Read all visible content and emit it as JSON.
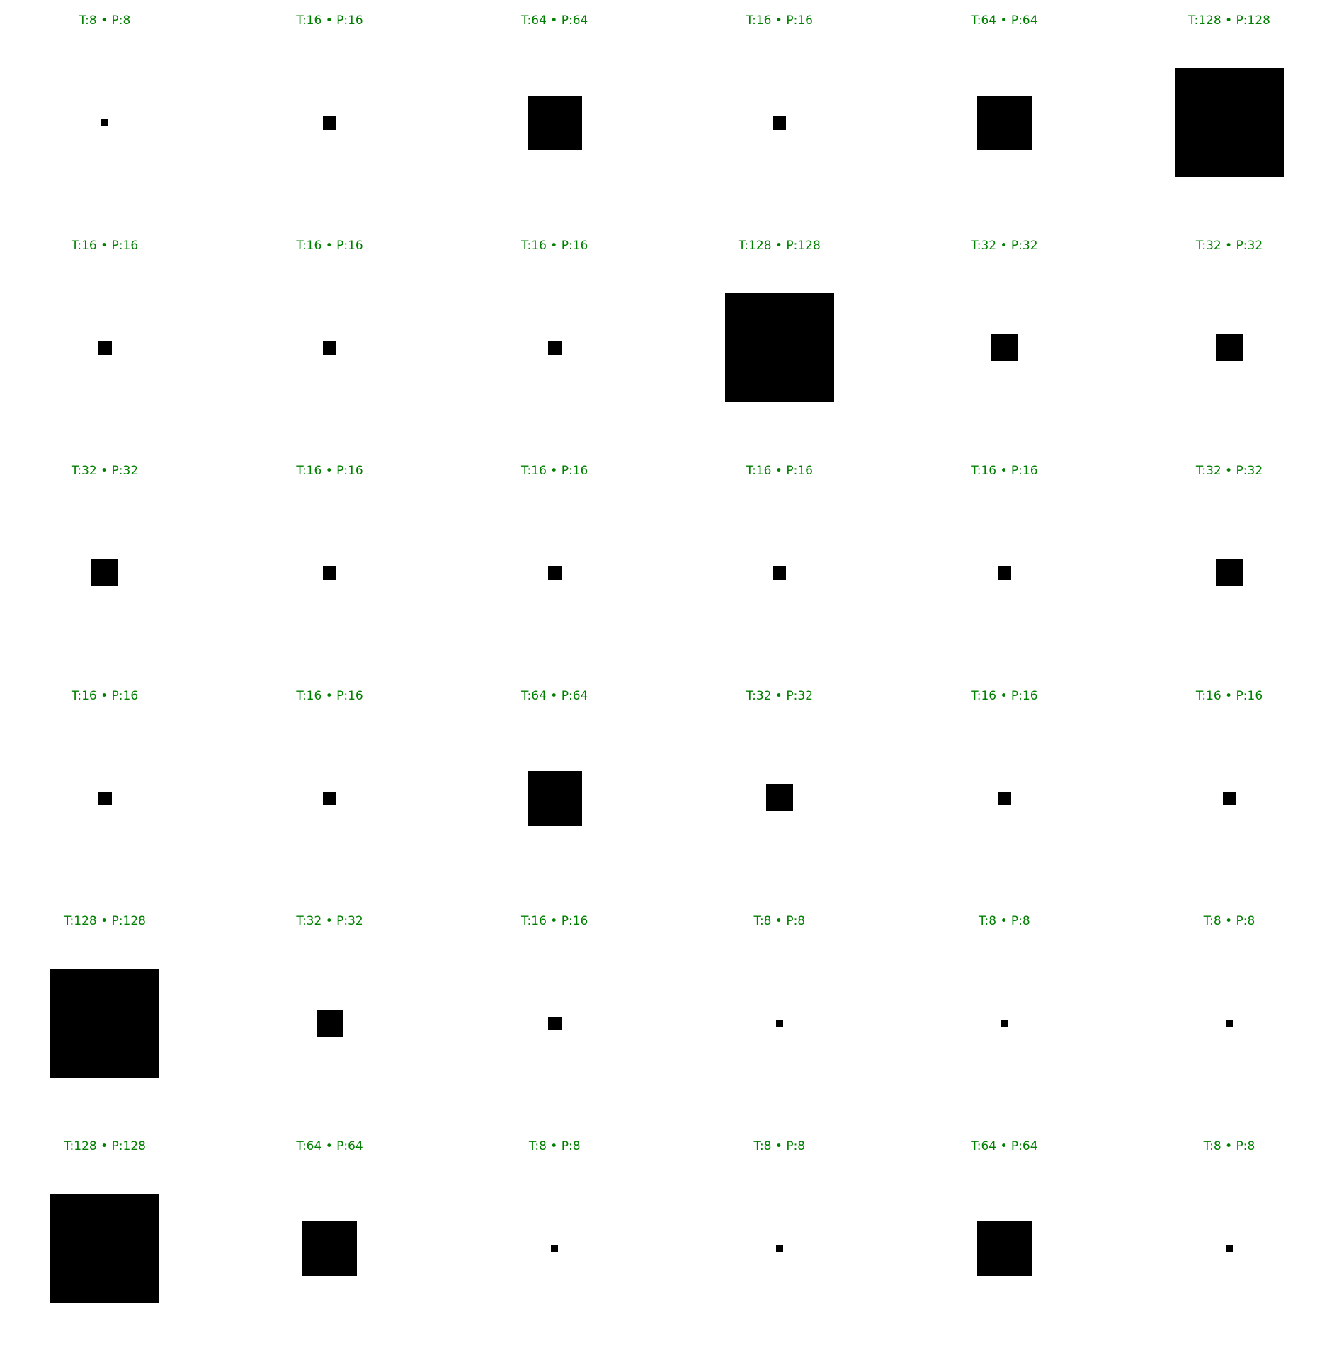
{
  "title_color": "#008000",
  "square_color": "#000000",
  "grid": {
    "columns": 6,
    "rows": 6,
    "cells": [
      {
        "label": "T:8 • P:8",
        "size": 8
      },
      {
        "label": "T:16 • P:16",
        "size": 16
      },
      {
        "label": "T:64 • P:64",
        "size": 64
      },
      {
        "label": "T:16 • P:16",
        "size": 16
      },
      {
        "label": "T:64 • P:64",
        "size": 64
      },
      {
        "label": "T:128 • P:128",
        "size": 128
      },
      {
        "label": "T:16 • P:16",
        "size": 16
      },
      {
        "label": "T:16 • P:16",
        "size": 16
      },
      {
        "label": "T:16 • P:16",
        "size": 16
      },
      {
        "label": "T:128 • P:128",
        "size": 128
      },
      {
        "label": "T:32 • P:32",
        "size": 32
      },
      {
        "label": "T:32 • P:32",
        "size": 32
      },
      {
        "label": "T:32 • P:32",
        "size": 32
      },
      {
        "label": "T:16 • P:16",
        "size": 16
      },
      {
        "label": "T:16 • P:16",
        "size": 16
      },
      {
        "label": "T:16 • P:16",
        "size": 16
      },
      {
        "label": "T:16 • P:16",
        "size": 16
      },
      {
        "label": "T:32 • P:32",
        "size": 32
      },
      {
        "label": "T:16 • P:16",
        "size": 16
      },
      {
        "label": "T:16 • P:16",
        "size": 16
      },
      {
        "label": "T:64 • P:64",
        "size": 64
      },
      {
        "label": "T:32 • P:32",
        "size": 32
      },
      {
        "label": "T:16 • P:16",
        "size": 16
      },
      {
        "label": "T:16 • P:16",
        "size": 16
      },
      {
        "label": "T:128 • P:128",
        "size": 128
      },
      {
        "label": "T:32 • P:32",
        "size": 32
      },
      {
        "label": "T:16 • P:16",
        "size": 16
      },
      {
        "label": "T:8 • P:8",
        "size": 8
      },
      {
        "label": "T:8 • P:8",
        "size": 8
      },
      {
        "label": "T:8 • P:8",
        "size": 8
      },
      {
        "label": "T:128 • P:128",
        "size": 128
      },
      {
        "label": "T:64 • P:64",
        "size": 64
      },
      {
        "label": "T:8 • P:8",
        "size": 8
      },
      {
        "label": "T:8 • P:8",
        "size": 8
      },
      {
        "label": "T:64 • P:64",
        "size": 64
      },
      {
        "label": "T:8 • P:8",
        "size": 8
      }
    ]
  }
}
